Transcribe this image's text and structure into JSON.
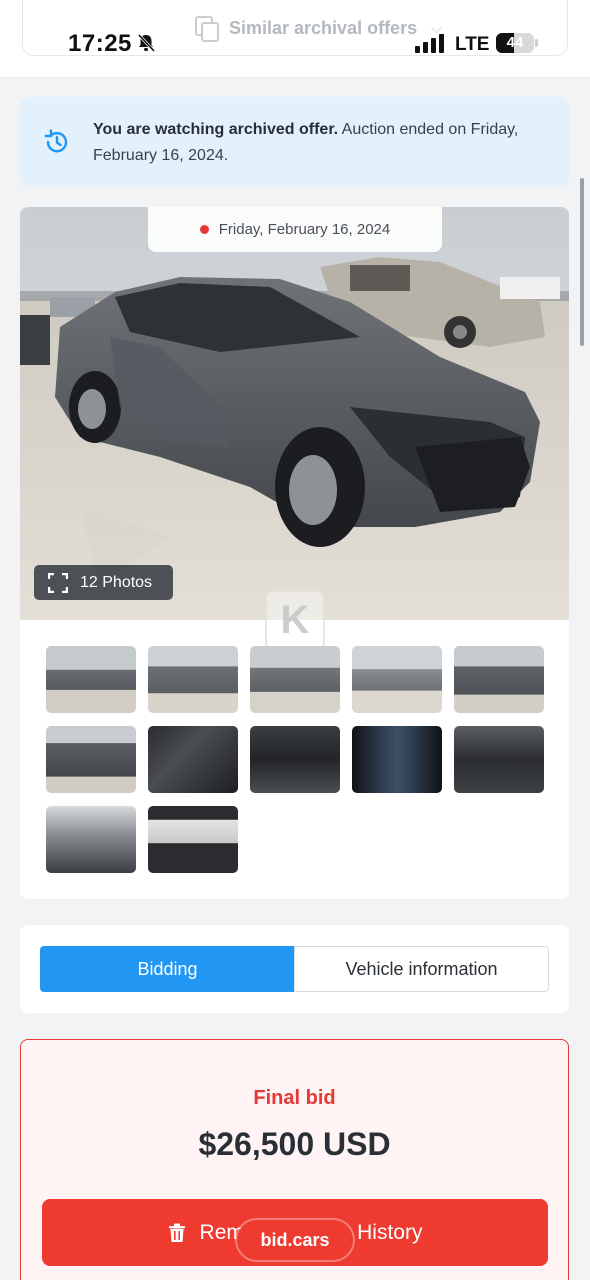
{
  "status_bar": {
    "time": "17:25",
    "network": "LTE",
    "battery": "44"
  },
  "top_bar": {
    "similar_label": "Similar archival offers"
  },
  "notice": {
    "bold": "You are watching archived offer.",
    "rest": " Auction ended on Friday, February 16, 2024."
  },
  "gallery": {
    "date": "Friday, February 16, 2024",
    "photos_label": "12 Photos",
    "thumb_count": 12
  },
  "tabs": {
    "bidding": "Bidding",
    "vehicle_info": "Vehicle information"
  },
  "final_bid": {
    "label": "Final bid",
    "value": "$26,500 USD",
    "button": "Remove Vehicle History"
  },
  "badge": {
    "label": "bid.cars"
  },
  "colors": {
    "accent_blue": "#2196f3",
    "notice_bg": "#e3f1fd",
    "bid_red": "#e53935",
    "button_red": "#ee3a2f"
  }
}
